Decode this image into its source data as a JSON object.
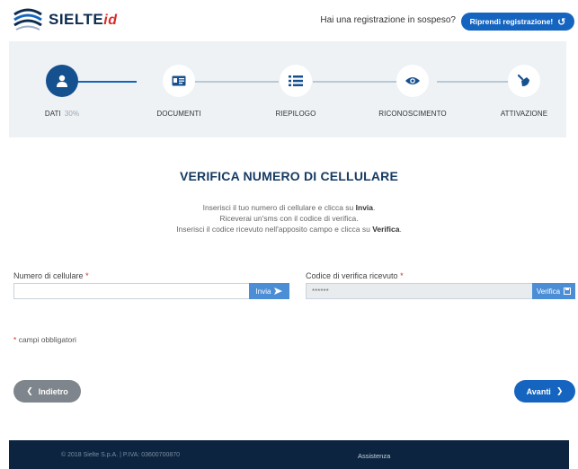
{
  "header": {
    "logo_text": "SIELTE",
    "logo_suffix": "id",
    "pending_text": "Hai una registrazione in sospeso?",
    "resume_label": "Riprendi registrazione!"
  },
  "steps": [
    {
      "label": "DATI",
      "percent": "30%",
      "icon": "user-icon",
      "active": true
    },
    {
      "label": "DOCUMENTI",
      "icon": "id-card-icon",
      "active": false
    },
    {
      "label": "RIEPILOGO",
      "icon": "list-icon",
      "active": false
    },
    {
      "label": "RICONOSCIMENTO",
      "icon": "eye-icon",
      "active": false
    },
    {
      "label": "ATTIVAZIONE",
      "icon": "pen-icon",
      "active": false
    }
  ],
  "main": {
    "title": "VERIFICA NUMERO DI CELLULARE",
    "instructions": {
      "line1_pre": "Inserisci il tuo numero di cellulare e clicca su ",
      "line1_bold": "Invia",
      "line1_post": ".",
      "line2": "Riceverai un'sms con il codice di verifica.",
      "line3_pre": "Inserisci il codice ricevuto nell'apposito campo e clicca su ",
      "line3_bold": "Verifica",
      "line3_post": "."
    }
  },
  "form": {
    "phone_label": "Numero di cellulare",
    "phone_value": "",
    "send_label": "Invia",
    "code_label": "Codice di verifica ricevuto",
    "code_placeholder": "******",
    "verify_label": "Verifica",
    "required_star": "*",
    "required_note": "campi obbligatori"
  },
  "nav": {
    "back_label": "Indietro",
    "next_label": "Avanti"
  },
  "footer": {
    "copyright": "© 2018 Sielte S.p.A. | P.IVA: 03600700870",
    "assistance": "Assistenza"
  },
  "colors": {
    "primary": "#1565c0",
    "navy": "#0c2440",
    "accent_red": "#d92c28",
    "steps_bg": "#eef2f5"
  }
}
